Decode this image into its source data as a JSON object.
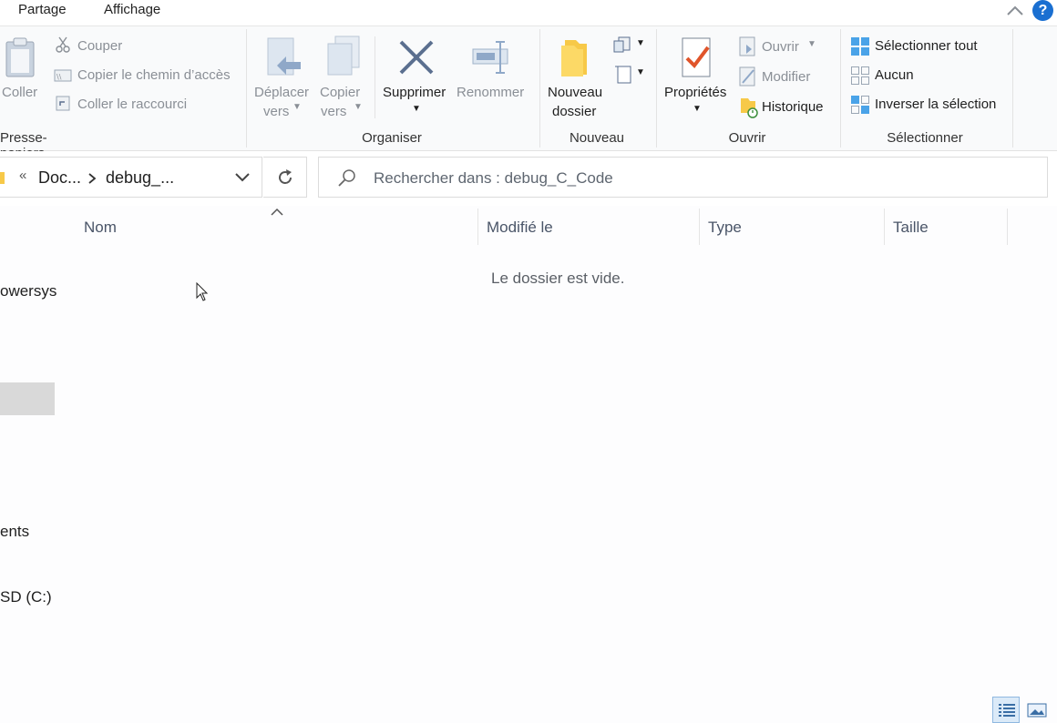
{
  "tabs": [
    "Partage",
    "Affichage"
  ],
  "clipboard": {
    "paste": "Coller",
    "cut": "Couper",
    "copy_path": "Copier le chemin d’accès",
    "paste_shortcut": "Coller le raccourci",
    "group": "Presse-papiers"
  },
  "organize": {
    "move_to_1": "Déplacer",
    "move_to_2": "vers",
    "copy_to_1": "Copier",
    "copy_to_2": "vers",
    "delete": "Supprimer",
    "rename": "Renommer",
    "group": "Organiser"
  },
  "new": {
    "new_folder_1": "Nouveau",
    "new_folder_2": "dossier",
    "group": "Nouveau"
  },
  "open": {
    "properties": "Propriétés",
    "open": "Ouvrir",
    "edit": "Modifier",
    "history": "Historique",
    "group": "Ouvrir"
  },
  "select": {
    "select_all": "Sélectionner tout",
    "none": "Aucun",
    "invert": "Inverser la sélection",
    "group": "Sélectionner"
  },
  "address": {
    "chevrons": "«",
    "crumb1": "Doc...",
    "crumb2": "debug_..."
  },
  "search": {
    "placeholder": "Rechercher dans : debug_C_Code"
  },
  "columns": [
    "Nom",
    "Modifié le",
    "Type",
    "Taille"
  ],
  "empty_message": "Le dossier est vide.",
  "nav": {
    "item1": "owersys",
    "item2": "ents",
    "item3": "SD (C:)"
  },
  "colors": {
    "accent": "#1a6fd1",
    "folder": "#f7c948",
    "delete_x": "#5b6f8f"
  }
}
